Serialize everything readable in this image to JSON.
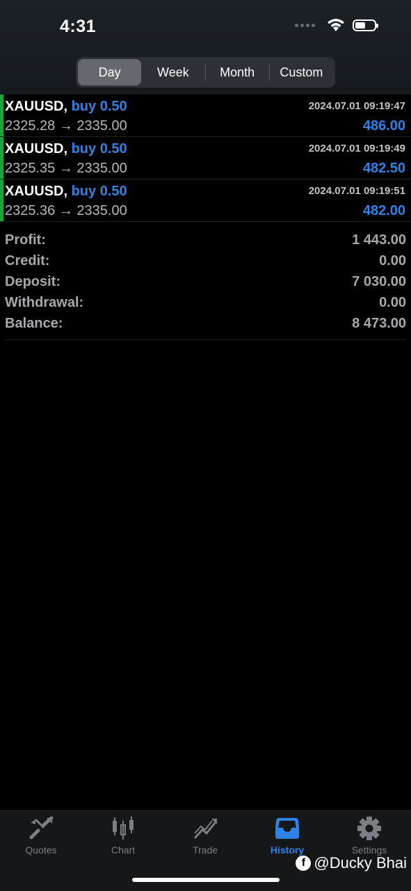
{
  "status_bar": {
    "time": "4:31"
  },
  "period_tabs": [
    "Day",
    "Week",
    "Month",
    "Custom"
  ],
  "active_period": "Day",
  "trades": [
    {
      "symbol": "XAUUSD,",
      "direction": "buy 0.50",
      "datetime": "2024.07.01 09:19:47",
      "prices": "2325.28 → 2335.00",
      "profit": "486.00"
    },
    {
      "symbol": "XAUUSD,",
      "direction": "buy 0.50",
      "datetime": "2024.07.01 09:19:49",
      "prices": "2325.35 → 2335.00",
      "profit": "482.50"
    },
    {
      "symbol": "XAUUSD,",
      "direction": "buy 0.50",
      "datetime": "2024.07.01 09:19:51",
      "prices": "2325.36 → 2335.00",
      "profit": "482.00"
    }
  ],
  "summary": [
    {
      "label": "Profit:",
      "value": "1 443.00"
    },
    {
      "label": "Credit:",
      "value": "0.00"
    },
    {
      "label": "Deposit:",
      "value": "7 030.00"
    },
    {
      "label": "Withdrawal:",
      "value": "0.00"
    },
    {
      "label": "Balance:",
      "value": "8 473.00"
    }
  ],
  "tabbar": [
    {
      "label": "Quotes",
      "icon": "quotes-icon"
    },
    {
      "label": "Chart",
      "icon": "chart-icon"
    },
    {
      "label": "Trade",
      "icon": "trade-icon"
    },
    {
      "label": "History",
      "icon": "history-icon"
    },
    {
      "label": "Settings",
      "icon": "gear-icon"
    }
  ],
  "active_tab": "History",
  "watermark": {
    "icon": "facebook-icon",
    "text": "@Ducky Bhai"
  },
  "colors": {
    "accent": "#2f82e6",
    "buy_bar": "#1fa33a",
    "background": "#000000"
  }
}
